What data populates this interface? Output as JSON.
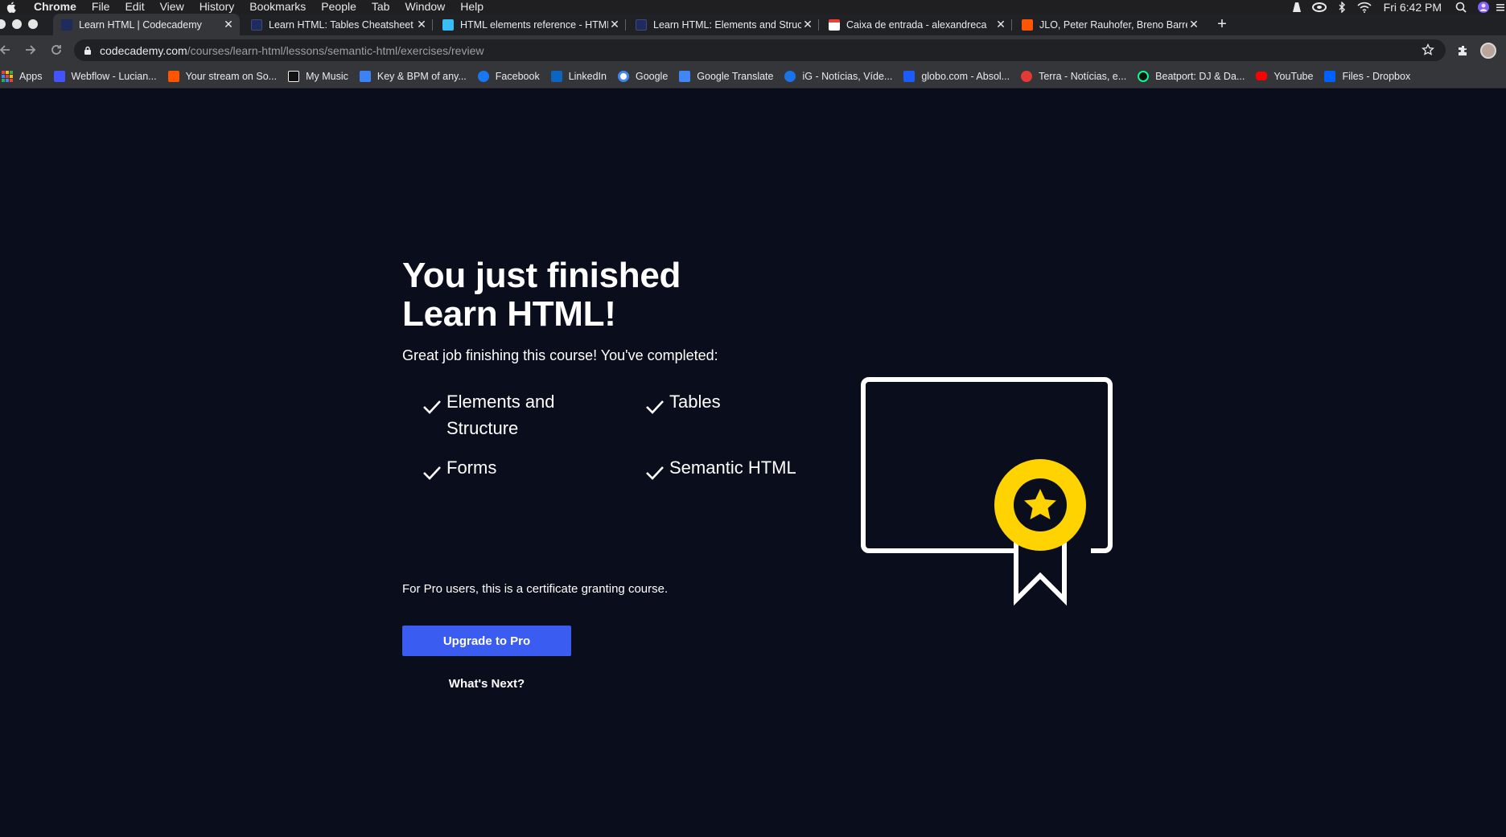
{
  "menubar": {
    "app": "Chrome",
    "items": [
      "File",
      "Edit",
      "View",
      "History",
      "Bookmarks",
      "People",
      "Tab",
      "Window",
      "Help"
    ],
    "clock": "Fri 6:42 PM"
  },
  "tabs": [
    {
      "title": "Learn HTML | Codecademy",
      "favicon_color": "#1f2b5c",
      "active": true
    },
    {
      "title": "Learn HTML: Tables Cheatsheet",
      "favicon_color": "#1f2b5c",
      "active": false
    },
    {
      "title": "HTML elements reference - HTML",
      "favicon_color": "#38bdf8",
      "active": false
    },
    {
      "title": "Learn HTML: Elements and Structure",
      "favicon_color": "#1f2b5c",
      "active": false
    },
    {
      "title": "Caixa de entrada - alexandreca",
      "favicon_color": "#ea4335",
      "active": false
    },
    {
      "title": "JLO, Peter Rauhofer, Breno Barreto",
      "favicon_color": "#ff5500",
      "active": false
    }
  ],
  "toolbar": {
    "url_host": "codecademy.com",
    "url_path": "/courses/learn-html/lessons/semantic-html/exercises/review"
  },
  "bookmarks": [
    {
      "label": "Apps",
      "icon_color": "#4285f4"
    },
    {
      "label": "Webflow - Lucian...",
      "icon_color": "#4353ff"
    },
    {
      "label": "Your stream on So...",
      "icon_color": "#ff5500"
    },
    {
      "label": "My Music",
      "icon_color": "#111111"
    },
    {
      "label": "Key & BPM of any...",
      "icon_color": "#3b82f6"
    },
    {
      "label": "Facebook",
      "icon_color": "#1877f2"
    },
    {
      "label": "LinkedIn",
      "icon_color": "#0a66c2"
    },
    {
      "label": "Google",
      "icon_color": "#ffffff"
    },
    {
      "label": "Google Translate",
      "icon_color": "#4285f4"
    },
    {
      "label": "iG - Notícias, Víde...",
      "icon_color": "#1a73e8"
    },
    {
      "label": "globo.com - Absol...",
      "icon_color": "#1a5cff"
    },
    {
      "label": "Terra - Notícias, e...",
      "icon_color": "#e53935"
    },
    {
      "label": "Beatport: DJ & Da...",
      "icon_color": "#01ff95"
    },
    {
      "label": "YouTube",
      "icon_color": "#ff0000"
    },
    {
      "label": "Files - Dropbox",
      "icon_color": "#0061fe"
    }
  ],
  "main": {
    "headline_line1": "You just finished",
    "headline_line2": "Learn HTML!",
    "subtitle": "Great job finishing this course! You've completed:",
    "completed": [
      {
        "line1": "Elements and",
        "line2": "Structure"
      },
      {
        "line1": "Tables",
        "line2": ""
      },
      {
        "line1": "Forms",
        "line2": ""
      },
      {
        "line1": "Semantic HTML",
        "line2": ""
      }
    ],
    "pro_note": "For Pro users, this is a certificate granting course.",
    "upgrade_label": "Upgrade to Pro",
    "whats_next_label": "What's Next?"
  },
  "colors": {
    "page_bg": "#0a0d1c",
    "accent_blue": "#3a5cf0",
    "badge_yellow": "#ffd300"
  }
}
